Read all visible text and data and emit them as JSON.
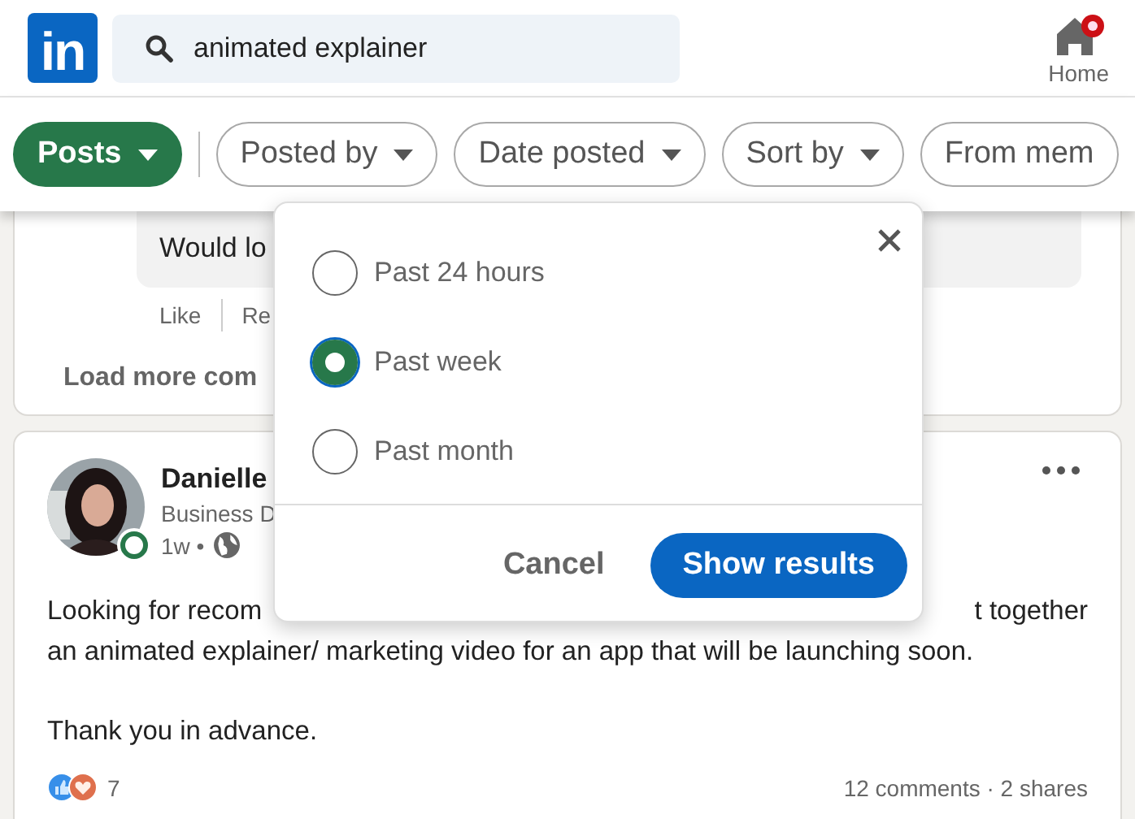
{
  "header": {
    "logo": "in",
    "search": {
      "value": "animated explainer"
    },
    "nav": [
      {
        "label": "Home",
        "badge": true
      }
    ]
  },
  "filters": [
    {
      "label": "Posts",
      "selected": true
    },
    {
      "label": "Posted by",
      "selected": false
    },
    {
      "label": "Date posted",
      "selected": false
    },
    {
      "label": "Sort by",
      "selected": false
    },
    {
      "label": "From mem",
      "selected": false
    }
  ],
  "comment": {
    "text": "Would lo",
    "actions": [
      "Like",
      "Re"
    ]
  },
  "load_more": "Load more com",
  "post": {
    "author": "Danielle",
    "headline": "Business D",
    "time": "1w •",
    "online": true,
    "body": [
      [
        [
          "Looking for recom",
          "t together"
        ],
        [
          "an animated explainer/ marketing video for an app that will be launching soon."
        ]
      ],
      [
        [
          "Thank you in advance."
        ]
      ]
    ],
    "reaction_count": "7",
    "stats": "12 comments · 2 shares"
  },
  "popover": {
    "options": [
      {
        "label": "Past 24 hours",
        "selected": false
      },
      {
        "label": "Past week",
        "selected": true
      },
      {
        "label": "Past month",
        "selected": false
      }
    ],
    "cancel": "Cancel",
    "submit": "Show results"
  }
}
